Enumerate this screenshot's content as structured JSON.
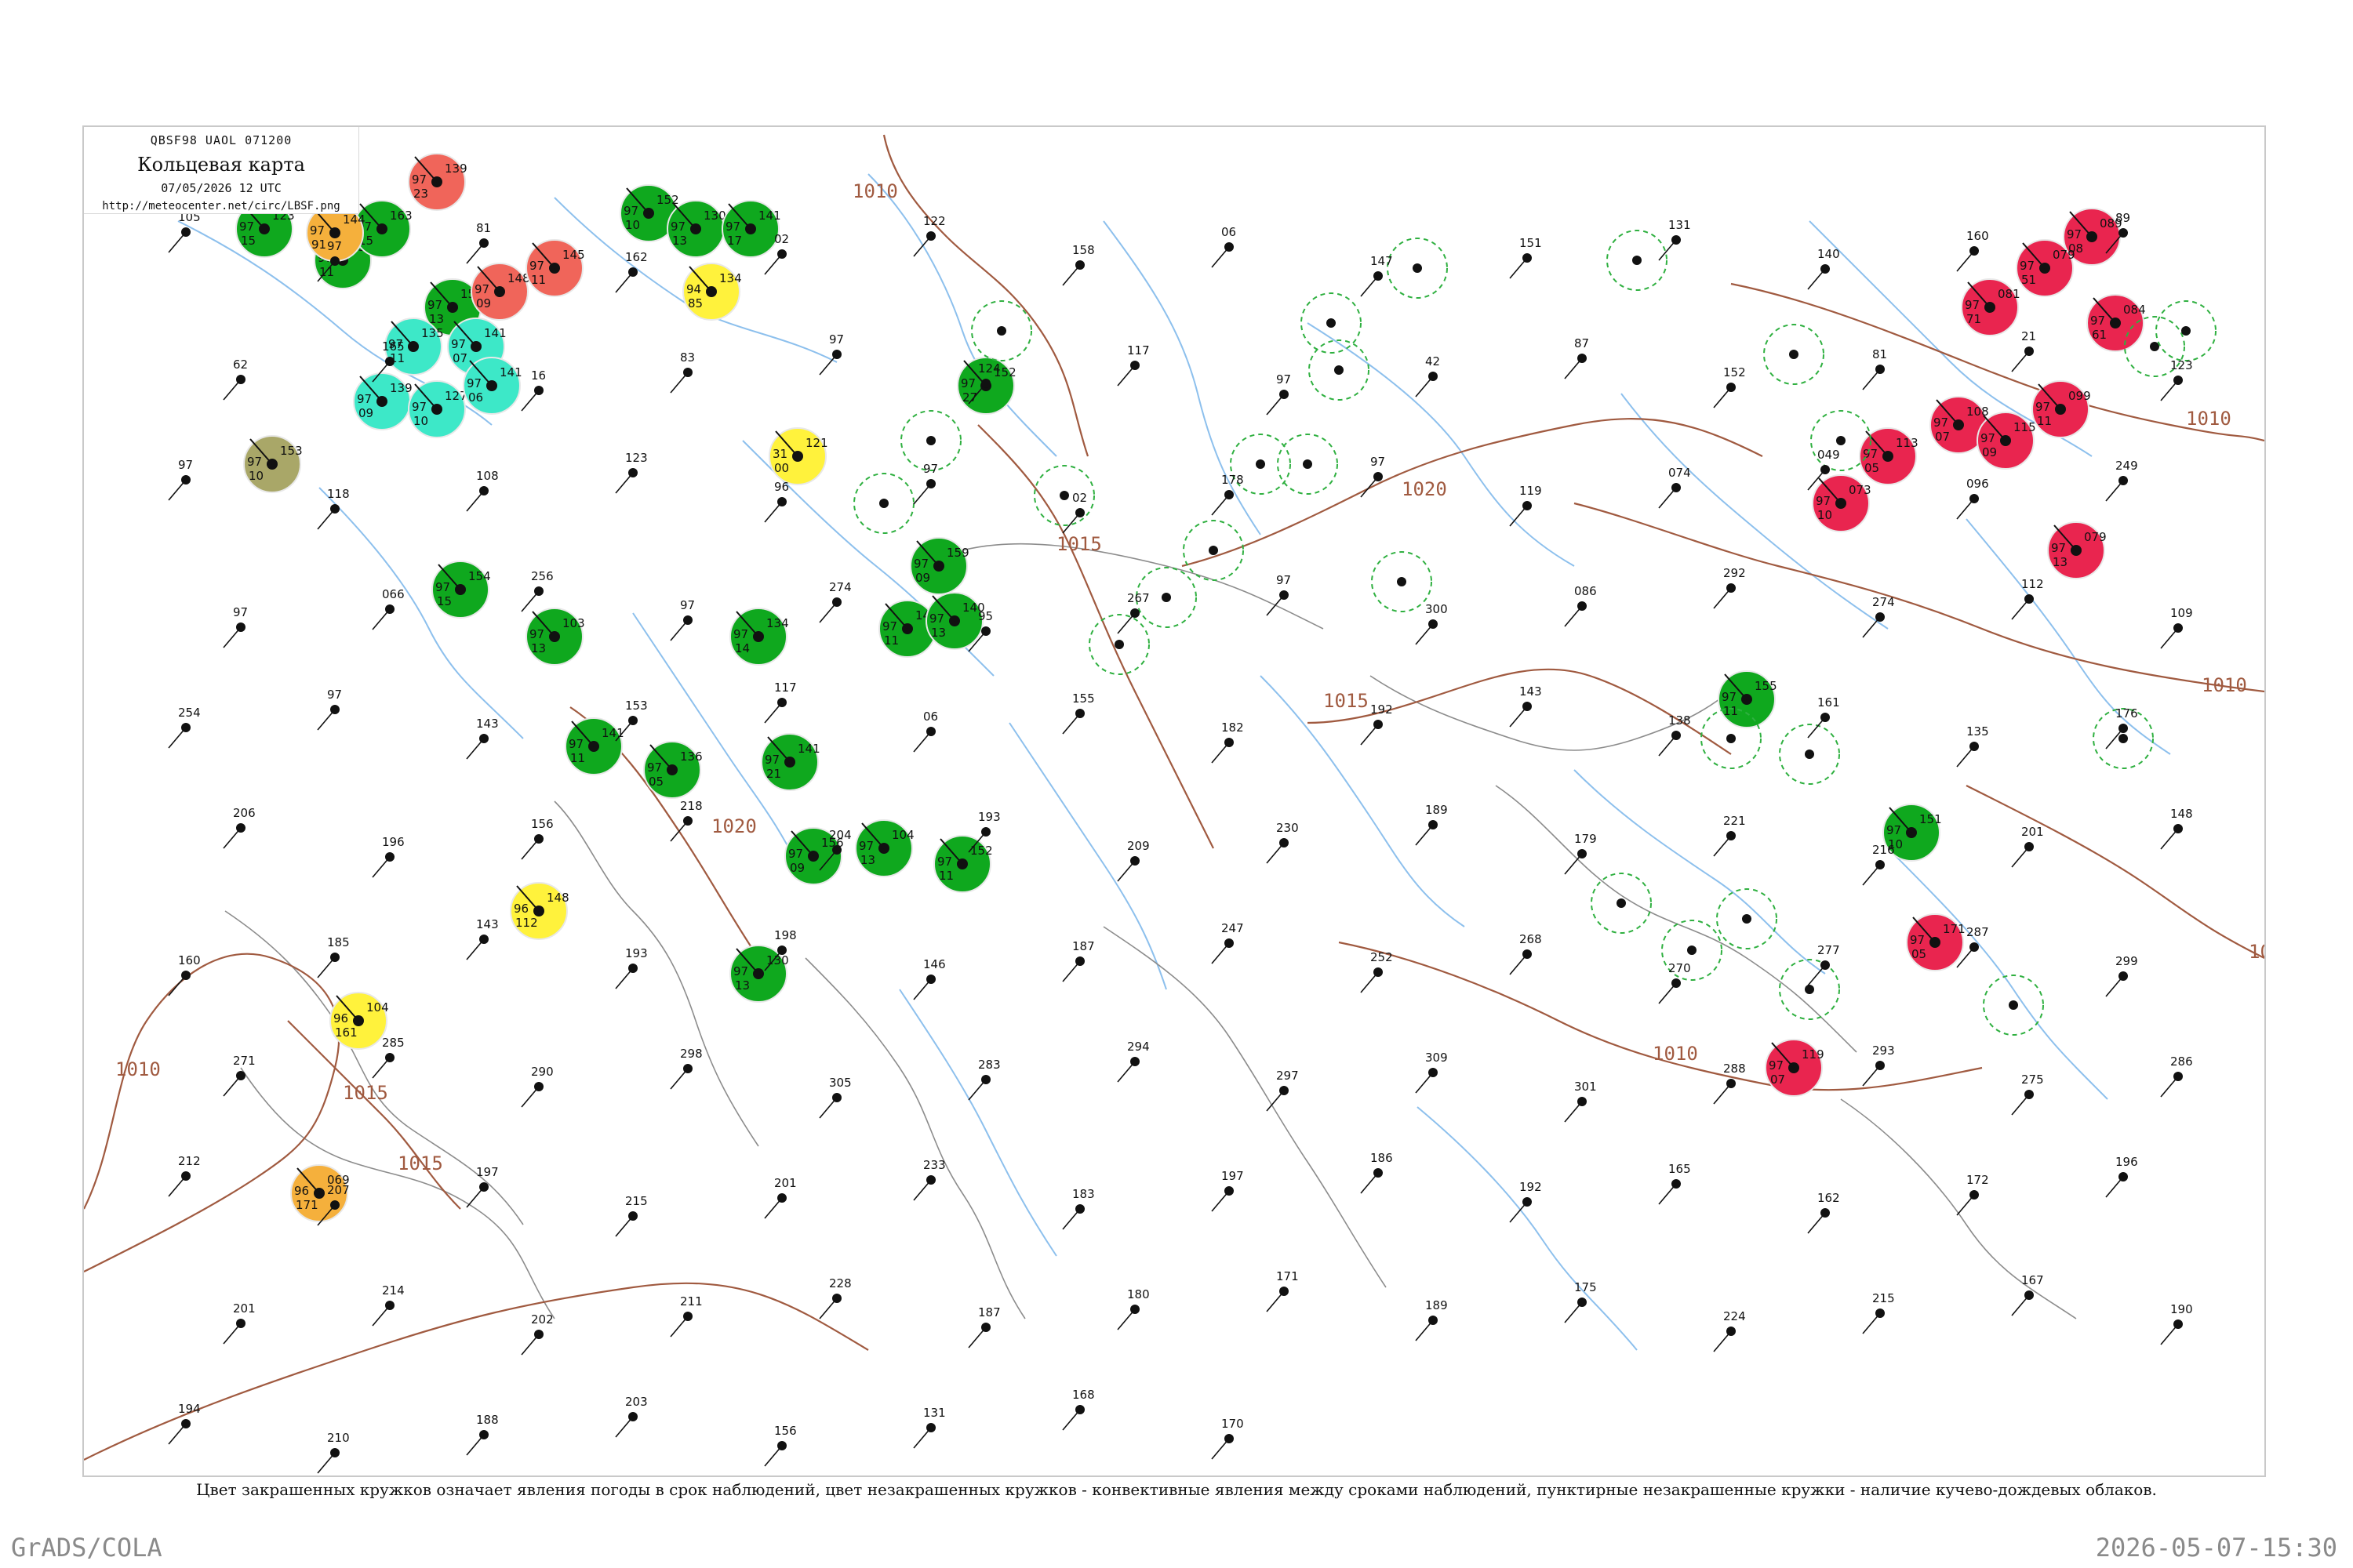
{
  "header": {
    "code": "QBSF98  UAOL  071200",
    "title": "Кольцевая карта",
    "datetime": "07/05/2026 12 UTC",
    "url": "http://meteocenter.net/circ/LBSF.png"
  },
  "isobars": [
    {
      "label": "1010"
    },
    {
      "label": "1015"
    },
    {
      "label": "1010"
    },
    {
      "label": "1015"
    },
    {
      "label": "1020"
    },
    {
      "label": "1015"
    },
    {
      "label": "1010"
    },
    {
      "label": "1010"
    },
    {
      "label": "1015"
    },
    {
      "label": "1010"
    },
    {
      "label": "1020"
    },
    {
      "label": "1015"
    }
  ],
  "stations": [
    {
      "fill": "green",
      "v1": "123",
      "v2": "97",
      "v3": "15"
    },
    {
      "fill": "green",
      "v1": "130",
      "v2": "97",
      "v3": "11"
    },
    {
      "fill": "green",
      "v1": "163",
      "v2": "97",
      "v3": "15"
    },
    {
      "fill": "green",
      "v1": "154",
      "v2": "97",
      "v3": "13"
    },
    {
      "fill": "red",
      "v1": "139",
      "v2": "97",
      "v3": "23"
    },
    {
      "fill": "red",
      "v1": "148",
      "v2": "97",
      "v3": "09"
    },
    {
      "fill": "red",
      "v1": "145",
      "v2": "97",
      "v3": "11"
    },
    {
      "fill": "green",
      "v1": "152",
      "v2": "97",
      "v3": "10"
    },
    {
      "fill": "green",
      "v1": "130",
      "v2": "97",
      "v3": "13"
    },
    {
      "fill": "green",
      "v1": "141",
      "v2": "97",
      "v3": "17"
    },
    {
      "fill": "cyan",
      "v1": "135",
      "v2": "97",
      "v3": "11"
    },
    {
      "fill": "cyan",
      "v1": "141",
      "v2": "97",
      "v3": "07"
    },
    {
      "fill": "cyan",
      "v1": "139",
      "v2": "97",
      "v3": "09"
    },
    {
      "fill": "cyan",
      "v1": "127",
      "v2": "97",
      "v3": "10"
    },
    {
      "fill": "cyan",
      "v1": "141",
      "v2": "97",
      "v3": "06"
    },
    {
      "fill": "olive",
      "v1": "153",
      "v2": "97",
      "v3": "10"
    },
    {
      "fill": "orange",
      "v1": "144",
      "v2": "97",
      "v3": "91"
    },
    {
      "fill": "yellow",
      "v1": "134",
      "v2": "94",
      "v3": "85"
    },
    {
      "fill": "yellow",
      "v1": "121",
      "v2": "31",
      "v3": "00"
    },
    {
      "fill": "green",
      "v1": "152",
      "v2": "97",
      "v3": "27"
    },
    {
      "fill": "green",
      "v1": "148",
      "v2": "97",
      "v3": "11"
    },
    {
      "fill": "green",
      "v1": "134",
      "v2": "97",
      "v3": "14"
    },
    {
      "fill": "green",
      "v1": "103",
      "v2": "97",
      "v3": "13"
    },
    {
      "fill": "green",
      "v1": "154",
      "v2": "97",
      "v3": "15"
    },
    {
      "fill": "green",
      "v1": "141",
      "v2": "97",
      "v3": "11"
    },
    {
      "fill": "green",
      "v1": "136",
      "v2": "97",
      "v3": "05"
    },
    {
      "fill": "green",
      "v1": "141",
      "v2": "97",
      "v3": "21"
    },
    {
      "fill": "green",
      "v1": "156",
      "v2": "97",
      "v3": "09"
    },
    {
      "fill": "green",
      "v1": "104",
      "v2": "97",
      "v3": "13"
    },
    {
      "fill": "green",
      "v1": "152",
      "v2": "97",
      "v3": "11"
    },
    {
      "fill": "green",
      "v1": "130",
      "v2": "97",
      "v3": "13"
    },
    {
      "fill": "yellow",
      "v1": "148",
      "v2": "96",
      "v3": "112"
    },
    {
      "fill": "yellow",
      "v1": "104",
      "v2": "96",
      "v3": "161"
    },
    {
      "fill": "orange",
      "v1": "069",
      "v2": "96",
      "v3": "171"
    },
    {
      "fill": "green",
      "v1": "159",
      "v2": "97",
      "v3": "09"
    },
    {
      "fill": "green",
      "v1": "140",
      "v2": "97",
      "v3": "13"
    },
    {
      "fill": "green",
      "v1": "155",
      "v2": "97",
      "v3": "11"
    },
    {
      "fill": "green",
      "v1": "151",
      "v2": "97",
      "v3": "10"
    },
    {
      "fill": "red2",
      "v1": "089",
      "v2": "97",
      "v3": "08"
    },
    {
      "fill": "red2",
      "v1": "079",
      "v2": "97",
      "v3": "51"
    },
    {
      "fill": "red2",
      "v1": "081",
      "v2": "97",
      "v3": "71"
    },
    {
      "fill": "red2",
      "v1": "084",
      "v2": "97",
      "v3": "61"
    },
    {
      "fill": "red2",
      "v1": "113",
      "v2": "97",
      "v3": "05"
    },
    {
      "fill": "red2",
      "v1": "108",
      "v2": "97",
      "v3": "07"
    },
    {
      "fill": "red2",
      "v1": "115",
      "v2": "97",
      "v3": "09"
    },
    {
      "fill": "red2",
      "v1": "099",
      "v2": "97",
      "v3": "11"
    },
    {
      "fill": "red2",
      "v1": "073",
      "v2": "97",
      "v3": "10"
    },
    {
      "fill": "red2",
      "v1": "079",
      "v2": "97",
      "v3": "13"
    },
    {
      "fill": "red2",
      "v1": "171",
      "v2": "97",
      "v3": "05"
    },
    {
      "fill": "red2",
      "v1": "119",
      "v2": "97",
      "v3": "07"
    }
  ],
  "numbers": [
    "105",
    "97",
    "81",
    "162",
    "02",
    "122",
    "158",
    "06",
    "147",
    "151",
    "131",
    "140",
    "160",
    "89",
    "62",
    "165",
    "16",
    "83",
    "97",
    "124",
    "117",
    "97",
    "42",
    "87",
    "152",
    "81",
    "21",
    "123",
    "97",
    "118",
    "108",
    "123",
    "96",
    "97",
    "02",
    "178",
    "97",
    "119",
    "074",
    "049",
    "096",
    "249",
    "97",
    "066",
    "256",
    "97",
    "274",
    "95",
    "267",
    "97",
    "300",
    "086",
    "292",
    "274",
    "112",
    "109",
    "254",
    "97",
    "143",
    "153",
    "117",
    "06",
    "155",
    "182",
    "192",
    "143",
    "138",
    "161",
    "135",
    "176",
    "206",
    "196",
    "156",
    "218",
    "204",
    "193",
    "209",
    "230",
    "189",
    "179",
    "221",
    "216",
    "201",
    "148",
    "160",
    "185",
    "143",
    "193",
    "198",
    "146",
    "187",
    "247",
    "252",
    "268",
    "270",
    "277",
    "287",
    "299",
    "271",
    "285",
    "290",
    "298",
    "305",
    "283",
    "294",
    "297",
    "309",
    "301",
    "288",
    "293",
    "275",
    "286",
    "212",
    "207",
    "197",
    "215",
    "201",
    "233",
    "183",
    "197",
    "186",
    "192",
    "165",
    "162",
    "172",
    "196",
    "201",
    "214",
    "202",
    "211",
    "228",
    "187",
    "180",
    "171",
    "189",
    "175",
    "224",
    "215",
    "167",
    "190",
    "194",
    "210",
    "188",
    "203",
    "156",
    "131",
    "168",
    "170"
  ],
  "legend_text": "Цвет закрашенных кружков означает явления погоды в срок наблюдений, цвет незакрашенных кружков - конвективные явления между сроками наблюдений, пунктирные незакрашенные кружки - наличие кучево-дождевых облаков.",
  "footer": {
    "left": "GrADS/COLA",
    "right": "2026-05-07-15:30"
  },
  "colors": {
    "green": "#0fa81e",
    "red": "#f0655a",
    "red2": "#e9254f",
    "cyan": "#3de8c8",
    "yellow": "#fff23c",
    "orange": "#f5b03c",
    "olive": "#a9a768",
    "isobar": "#a05a40",
    "river": "#79b5ea",
    "coast": "#9a9a9a"
  }
}
